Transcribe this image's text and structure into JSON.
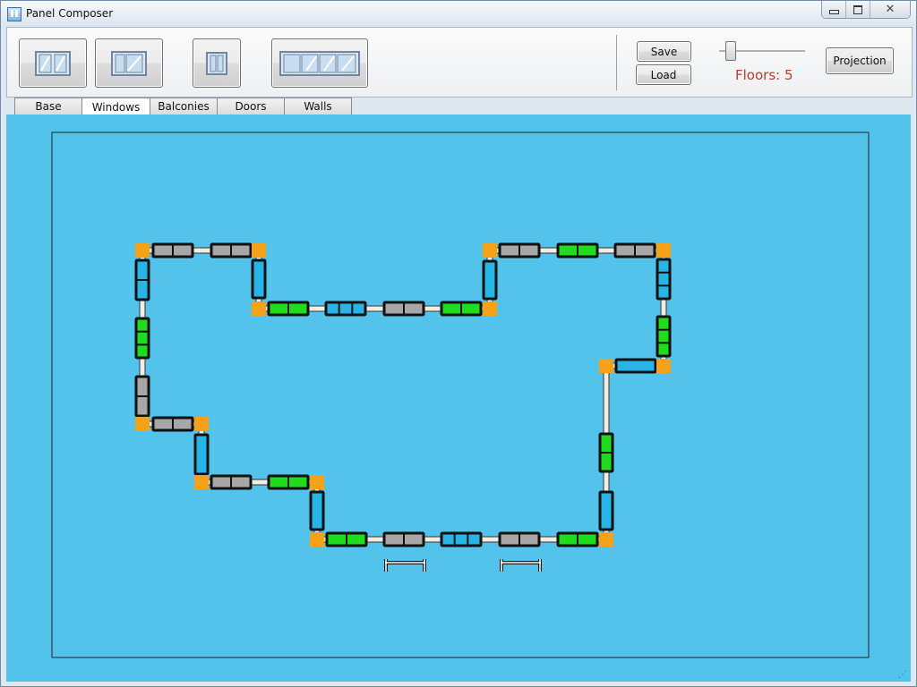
{
  "window": {
    "title": "Panel Composer",
    "buttons": [
      "minimize-icon",
      "restore-icon",
      "close-icon"
    ]
  },
  "toolbar": {
    "panel_buttons": [
      "window-panel-2-icon",
      "window-panel-2-icon",
      "window-panel-1-icon",
      "window-panel-4-icon"
    ],
    "save_label": "Save",
    "load_label": "Load",
    "floors_slider_value": 5,
    "floors_label": "Floors: 5",
    "projection_label": "Projection"
  },
  "tabs": [
    {
      "label": "Base"
    },
    {
      "label": "Windows",
      "active": true
    },
    {
      "label": "Balconies"
    },
    {
      "label": "Doors"
    },
    {
      "label": "Walls"
    }
  ],
  "colors": {
    "workspace": "#53c3ec",
    "corner": "#f5a219",
    "wall": "#f2ece2",
    "panel_gray": "#a7a7a7",
    "panel_green": "#1fdc1f",
    "panel_blue": "#27b4e6",
    "title_floors": "#c0392b"
  }
}
